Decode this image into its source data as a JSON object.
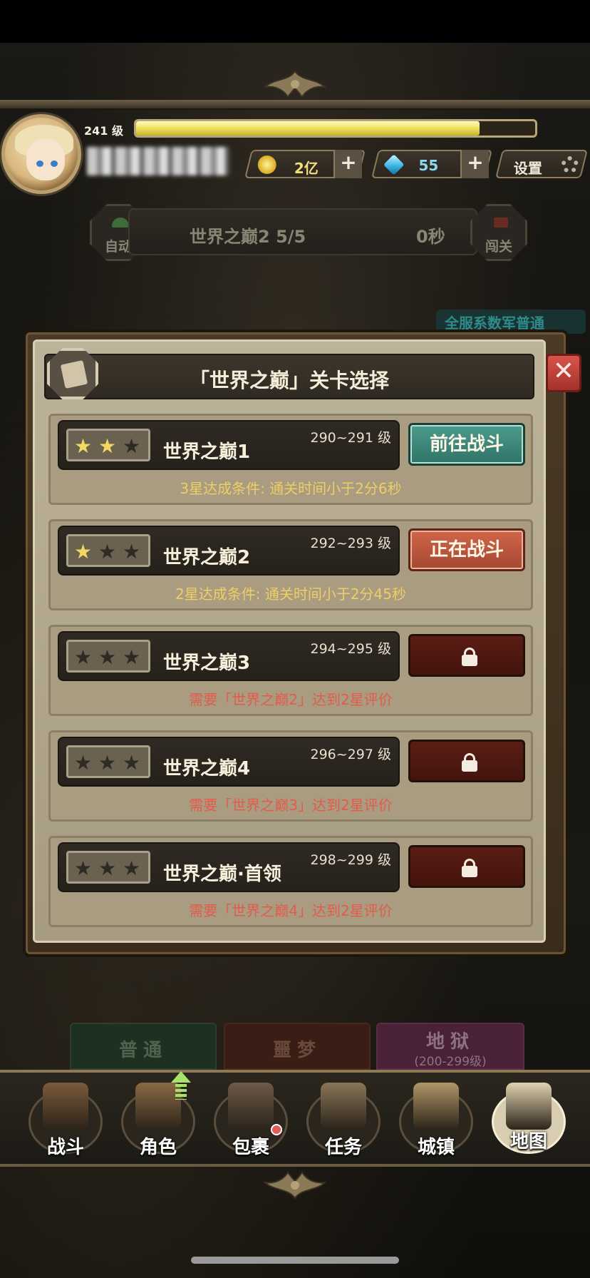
{
  "header": {
    "level": "241 级",
    "xp_progress": 0.86,
    "gold": "2亿",
    "gems": "55",
    "settings_label": "设置",
    "icons": {
      "gold": "gold-coin-icon",
      "gems": "diamond-icon",
      "plus": "+",
      "settings": "gear-icon"
    }
  },
  "battle": {
    "auto_label": "自动",
    "current_stage": "世界之巅2",
    "progress": "5/5",
    "timer": "0秒",
    "exit_label": "闯关"
  },
  "server_notice": "全服系数军普通",
  "modal": {
    "title": "「世界之巅」关卡选择",
    "close_symbol": "✕",
    "stages": [
      {
        "name": "世界之巅1",
        "level": "290~291 级",
        "stars": 2,
        "button": "前往战斗",
        "state": "go",
        "condition": "3星达成条件:  通关时间小于2分6秒",
        "condition_type": "ok"
      },
      {
        "name": "世界之巅2",
        "level": "292~293 级",
        "stars": 1,
        "button": "正在战斗",
        "state": "fighting",
        "condition": "2星达成条件:  通关时间小于2分45秒",
        "condition_type": "ok"
      },
      {
        "name": "世界之巅3",
        "level": "294~295 级",
        "stars": 0,
        "button": "",
        "state": "locked",
        "condition": "需要「世界之巅2」达到2星评价",
        "condition_type": "lock"
      },
      {
        "name": "世界之巅4",
        "level": "296~297 级",
        "stars": 0,
        "button": "",
        "state": "locked",
        "condition": "需要「世界之巅3」达到2星评价",
        "condition_type": "lock"
      },
      {
        "name": "世界之巅·首领",
        "level": "298~299 级",
        "stars": 0,
        "button": "",
        "state": "locked",
        "condition": "需要「世界之巅4」达到2星评价",
        "condition_type": "lock"
      }
    ]
  },
  "difficulty_tabs": [
    {
      "label": "普通",
      "sub": ""
    },
    {
      "label": "噩梦",
      "sub": ""
    },
    {
      "label": "地狱",
      "sub": "(200-299级)"
    }
  ],
  "nav": [
    {
      "label": "战斗",
      "icon": "sword-shield-icon",
      "color": "#7a5a3a"
    },
    {
      "label": "角色",
      "icon": "helmet-icon",
      "color": "#8a6a44",
      "upgrade": true
    },
    {
      "label": "包裹",
      "icon": "backpack-icon",
      "color": "#6e5a48",
      "badge": true
    },
    {
      "label": "任务",
      "icon": "scroll-icon",
      "color": "#8a7658"
    },
    {
      "label": "城镇",
      "icon": "castle-tower-icon",
      "color": "#b09668"
    },
    {
      "label": "地图",
      "icon": "map-icon",
      "color": "#e0d3b0",
      "active": true
    }
  ],
  "colors": {
    "accent_gold": "#efce64",
    "locked_red": "#e45b4c",
    "go_button": "#3d8a7d",
    "fighting_button": "#c0573d"
  }
}
